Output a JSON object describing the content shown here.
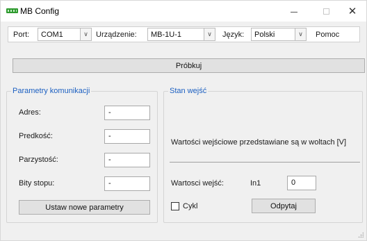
{
  "window": {
    "title": "MB Config",
    "accent_color": "#1b5fc1",
    "icon": "app-logo-icon"
  },
  "toolbar": {
    "port_label": "Port:",
    "port_value": "COM1",
    "device_label": "Urządzenie:",
    "device_value": "MB-1U-1",
    "language_label": "Język:",
    "language_value": "Polski",
    "help_label": "Pomoc"
  },
  "probe_button": "Próbkuj",
  "comm_params": {
    "title": "Parametry komunikacji",
    "address_label": "Adres:",
    "address_value": "-",
    "speed_label": "Predkość:",
    "speed_value": "-",
    "parity_label": "Parzystość:",
    "parity_value": "-",
    "stopbits_label": "Bity stopu:",
    "stopbits_value": "-",
    "set_button": "Ustaw nowe parametry"
  },
  "input_state": {
    "title": "Stan wejść",
    "info_text": "Wartości wejściowe przedstawiane są w woltach [V]",
    "values_label": "Wartosci wejść:",
    "channel_label": "In1",
    "channel_value": "0",
    "cycle_label": "Cykl",
    "cycle_checked": false,
    "query_button": "Odpytaj"
  }
}
